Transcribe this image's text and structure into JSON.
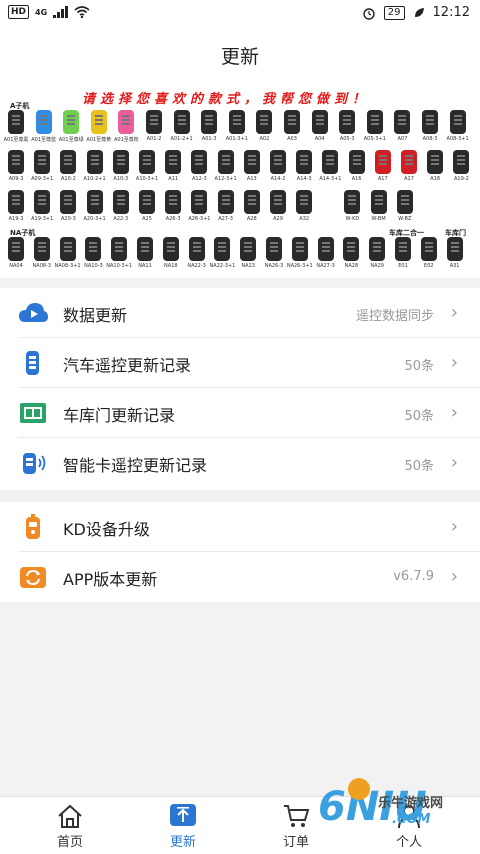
{
  "status_bar": {
    "hd": "HD",
    "network": "4G",
    "battery": "29",
    "time": "12:12"
  },
  "header": {
    "title": "更新"
  },
  "banner": {
    "headline": "请选择您喜欢的款式，我帮您做到！",
    "group_a": "A子机",
    "group_na": "NA子机",
    "group_garage2in1": "车库二合一",
    "group_garage": "车库门",
    "row1_labels": [
      "A01至尊黑",
      "A01至尊蓝",
      "A01至尊绿",
      "A01至尊黄",
      "A01至尊粉",
      "A01-2",
      "A01-2+1",
      "A01-3",
      "A01-3+1",
      "A02",
      "A03",
      "A04",
      "A05-3",
      "A05-3+1",
      "A07",
      "A08-3",
      "A08-3+1"
    ],
    "row2_labels": [
      "A09-3",
      "A09-3+1",
      "A10-2",
      "A10-2+1",
      "A10-3",
      "A10-3+1",
      "A11",
      "A12-3",
      "A12-3+1",
      "A13",
      "A14-2",
      "A14-3",
      "A14-3+1",
      "A16",
      "A17",
      "A17",
      "A18",
      "A19-2"
    ],
    "row3_labels": [
      "A19-3",
      "A19-3+1",
      "A20-3",
      "A20-3+1",
      "A22-3",
      "A25",
      "A26-3",
      "A26-3+1",
      "A27-3",
      "A28",
      "A29",
      "A32",
      "W-KD",
      "W-BM",
      "W-BZ"
    ],
    "row4_labels": [
      "NA04",
      "NA08-3",
      "NA08-3+1",
      "NA10-3",
      "NA10-3+1",
      "NA11",
      "NA18",
      "NA22-3",
      "NA22-3+1",
      "NA23",
      "NA26-3",
      "NA26-3+1",
      "NA27-3",
      "NA28",
      "NA29",
      "E01",
      "E02",
      "A31"
    ]
  },
  "section1": {
    "rows": [
      {
        "icon": "cloud-play-icon",
        "label": "数据更新",
        "value": "遥控数据同步"
      },
      {
        "icon": "car-remote-icon",
        "label": "汽车遥控更新记录",
        "value": "50条"
      },
      {
        "icon": "garage-door-icon",
        "label": "车库门更新记录",
        "value": "50条"
      },
      {
        "icon": "smart-card-remote-icon",
        "label": "智能卡遥控更新记录",
        "value": "50条"
      }
    ]
  },
  "section2": {
    "rows": [
      {
        "icon": "kd-device-icon",
        "label": "KD设备升级",
        "value": ""
      },
      {
        "icon": "app-refresh-icon",
        "label": "APP版本更新",
        "value": "v6.7.9"
      }
    ]
  },
  "tabbar": {
    "tabs": [
      {
        "label": "首页",
        "icon": "home-icon"
      },
      {
        "label": "更新",
        "icon": "upload-icon"
      },
      {
        "label": "订单",
        "icon": "cart-icon"
      },
      {
        "label": "个人",
        "icon": "person-icon"
      }
    ],
    "active": "更新"
  },
  "watermark": {
    "brand": "乐牛游戏网",
    "big": "6NIU",
    "domain": ".COM"
  },
  "colors": {
    "accent": "#2a76d2",
    "headline_red": "#e31b1b",
    "orange": "#f08a24",
    "green": "#2aa36b"
  }
}
